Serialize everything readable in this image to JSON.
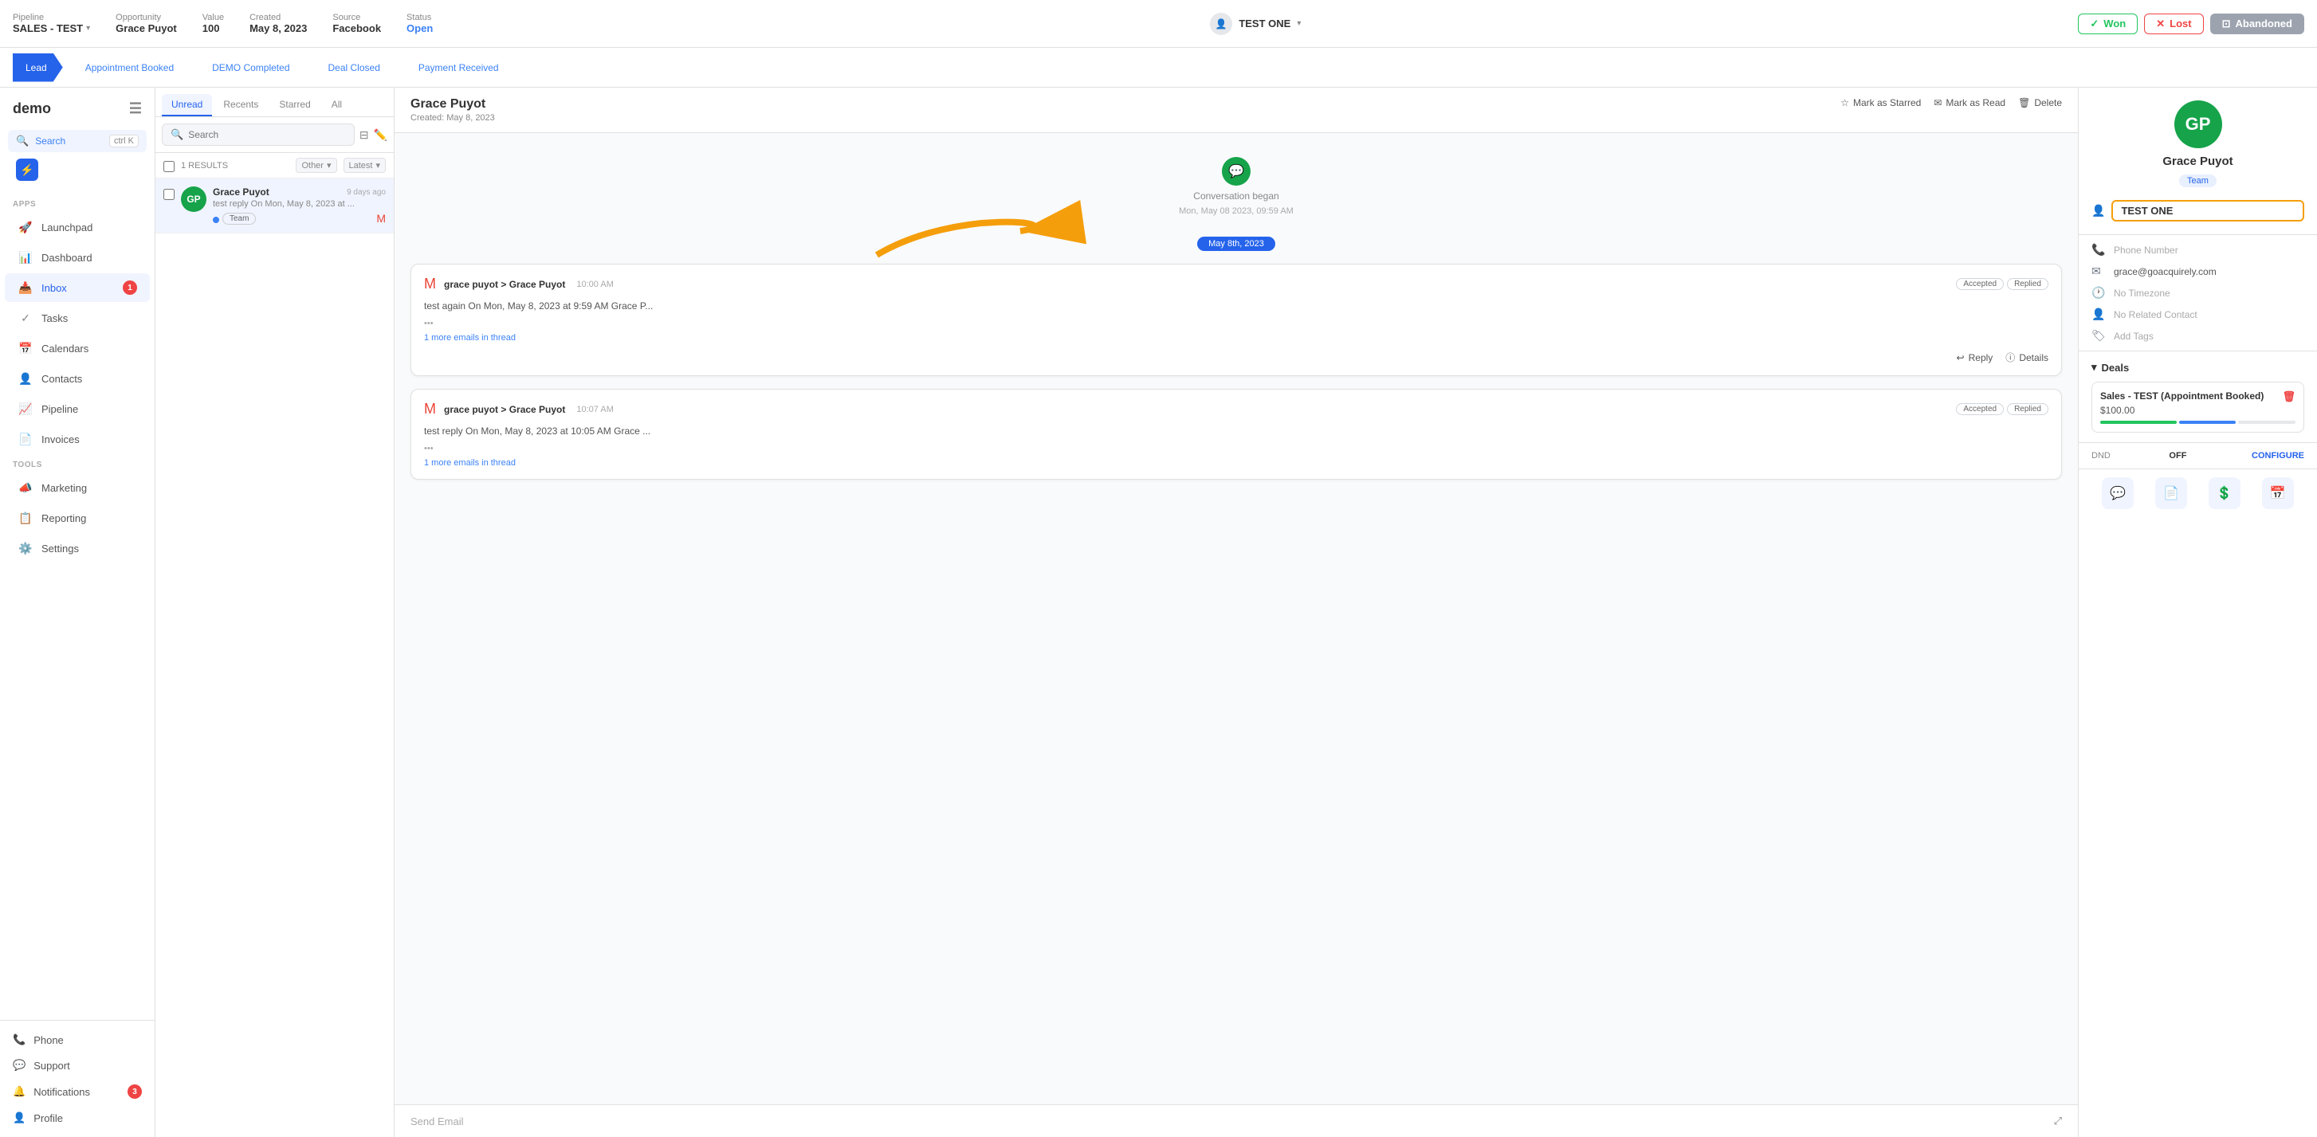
{
  "app": {
    "name": "demo"
  },
  "topbar": {
    "pipeline_label": "Pipeline",
    "pipeline_value": "SALES - TEST",
    "opportunity_label": "Opportunity",
    "opportunity_value": "Grace Puyot",
    "value_label": "Value",
    "value_value": "100",
    "created_label": "Created",
    "created_value": "May 8, 2023",
    "source_label": "Source",
    "source_value": "Facebook",
    "status_label": "Status",
    "status_value": "Open",
    "assignee_label": "TEST ONE",
    "won_label": "Won",
    "lost_label": "Lost",
    "abandoned_label": "Abandoned"
  },
  "stages": [
    {
      "label": "Lead",
      "active": true
    },
    {
      "label": "Appointment Booked",
      "active": false
    },
    {
      "label": "DEMO Completed",
      "active": false
    },
    {
      "label": "Deal Closed",
      "active": false
    },
    {
      "label": "Payment Received",
      "active": false
    }
  ],
  "sidebar": {
    "logo": "demo",
    "search_label": "Search",
    "search_shortcut": "ctrl K",
    "sections": {
      "apps_label": "Apps",
      "tools_label": "Tools"
    },
    "items": [
      {
        "label": "Launchpad",
        "icon": "🚀",
        "active": false
      },
      {
        "label": "Dashboard",
        "icon": "📊",
        "active": false
      },
      {
        "label": "Inbox",
        "icon": "📥",
        "active": true,
        "badge": 1
      },
      {
        "label": "Tasks",
        "icon": "✓",
        "active": false
      },
      {
        "label": "Calendars",
        "icon": "📅",
        "active": false
      },
      {
        "label": "Contacts",
        "icon": "👤",
        "active": false
      },
      {
        "label": "Pipeline",
        "icon": "📈",
        "active": false
      },
      {
        "label": "Invoices",
        "icon": "📄",
        "active": false
      },
      {
        "label": "Marketing",
        "icon": "📣",
        "active": false
      },
      {
        "label": "Reporting",
        "icon": "📋",
        "active": false
      },
      {
        "label": "Settings",
        "icon": "⚙️",
        "active": false
      }
    ],
    "bottom_items": [
      {
        "label": "Phone",
        "icon": "📞"
      },
      {
        "label": "Support",
        "icon": "💬"
      },
      {
        "label": "Notifications",
        "icon": "🔔",
        "badge": 3
      },
      {
        "label": "Profile",
        "icon": "👤"
      }
    ]
  },
  "inbox": {
    "tabs": [
      {
        "label": "Unread",
        "active": true
      },
      {
        "label": "Recents",
        "active": false
      },
      {
        "label": "Starred",
        "active": false
      },
      {
        "label": "All",
        "active": false
      }
    ],
    "search_placeholder": "Search",
    "results_count": "1 RESULTS",
    "filter_label": "Other",
    "sort_label": "Latest",
    "conversations": [
      {
        "name": "Grace Puyot",
        "preview": "test reply On Mon, May 8, 2023 at ...",
        "time": "9 days ago",
        "avatar_initials": "GP",
        "avatar_color": "#16a34a",
        "badges": [
          "Team"
        ],
        "has_gmail": true,
        "has_dot": true
      }
    ]
  },
  "conversation": {
    "contact_name": "Grace Puyot",
    "created": "Created: May 8, 2023",
    "actions": {
      "star": "Mark as Starred",
      "read": "Mark as Read",
      "delete": "Delete"
    },
    "started_text": "Conversation began",
    "started_time": "Mon, May 08 2023, 09:59 AM",
    "date_label": "May 8th, 2023",
    "messages": [
      {
        "from": "grace puyot > Grace Puyot",
        "time": "10:00 AM",
        "tags": [
          "Accepted",
          "Replied"
        ],
        "body": "test again On Mon, May 8, 2023 at 9:59 AM Grace P...",
        "more": "1 more emails in thread"
      },
      {
        "from": "grace puyot > Grace Puyot",
        "time": "10:07 AM",
        "tags": [
          "Accepted",
          "Replied"
        ],
        "body": "test reply On Mon, May 8, 2023 at 10:05 AM Grace ...",
        "more": "1 more emails in thread"
      }
    ],
    "reply_label": "Reply",
    "details_label": "Details",
    "send_email_placeholder": "Send Email"
  },
  "right_panel": {
    "contact_name": "Grace Puyot",
    "contact_initials": "GP",
    "contact_color": "#16a34a",
    "team_badge": "Team",
    "assigned_label": "TEST ONE",
    "phone_placeholder": "Phone Number",
    "email": "grace@goacquirely.com",
    "timezone": "No Timezone",
    "related_contact": "No Related Contact",
    "tags_placeholder": "Add Tags",
    "deals_title": "Deals",
    "deal": {
      "title": "Sales - TEST (Appointment Booked)",
      "amount": "$100.00",
      "progress": [
        {
          "width": 40,
          "color": "#22c55e"
        },
        {
          "width": 30,
          "color": "#3b82f6"
        },
        {
          "width": 30,
          "color": "#e5e7eb"
        }
      ]
    },
    "dnd_label": "DND",
    "dnd_value": "OFF",
    "configure_label": "CONFIGURE",
    "bottom_icons": [
      {
        "label": "chat",
        "icon": "💬"
      },
      {
        "label": "document",
        "icon": "📄"
      },
      {
        "label": "dollar",
        "icon": "💲"
      },
      {
        "label": "calendar",
        "icon": "📅"
      }
    ]
  }
}
